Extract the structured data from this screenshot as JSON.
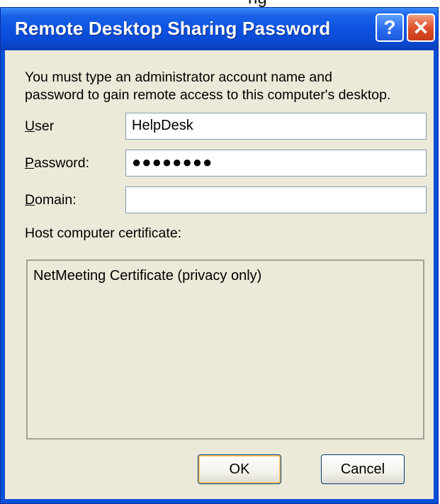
{
  "background_fragment": "ng",
  "window": {
    "title": "Remote Desktop Sharing Password",
    "help_button": "?",
    "close_button": "✕",
    "accent_color": "#0a4fd8"
  },
  "dialog": {
    "intro_line1": "You must type an administrator account name and",
    "intro_line2": "password to gain remote access to this computer's desktop.",
    "user": {
      "label_ul": "U",
      "label_rest": "ser",
      "value": "HelpDesk"
    },
    "password": {
      "label_ul": "P",
      "label_rest": "assword:",
      "value": "●●●●●●●●"
    },
    "domain": {
      "label_ul": "D",
      "label_rest": "omain:",
      "value": ""
    },
    "cert_label": "Host computer certificate:",
    "cert_text": "NetMeeting Certificate (privacy only)",
    "ok_label": "OK",
    "cancel_label": "Cancel"
  }
}
